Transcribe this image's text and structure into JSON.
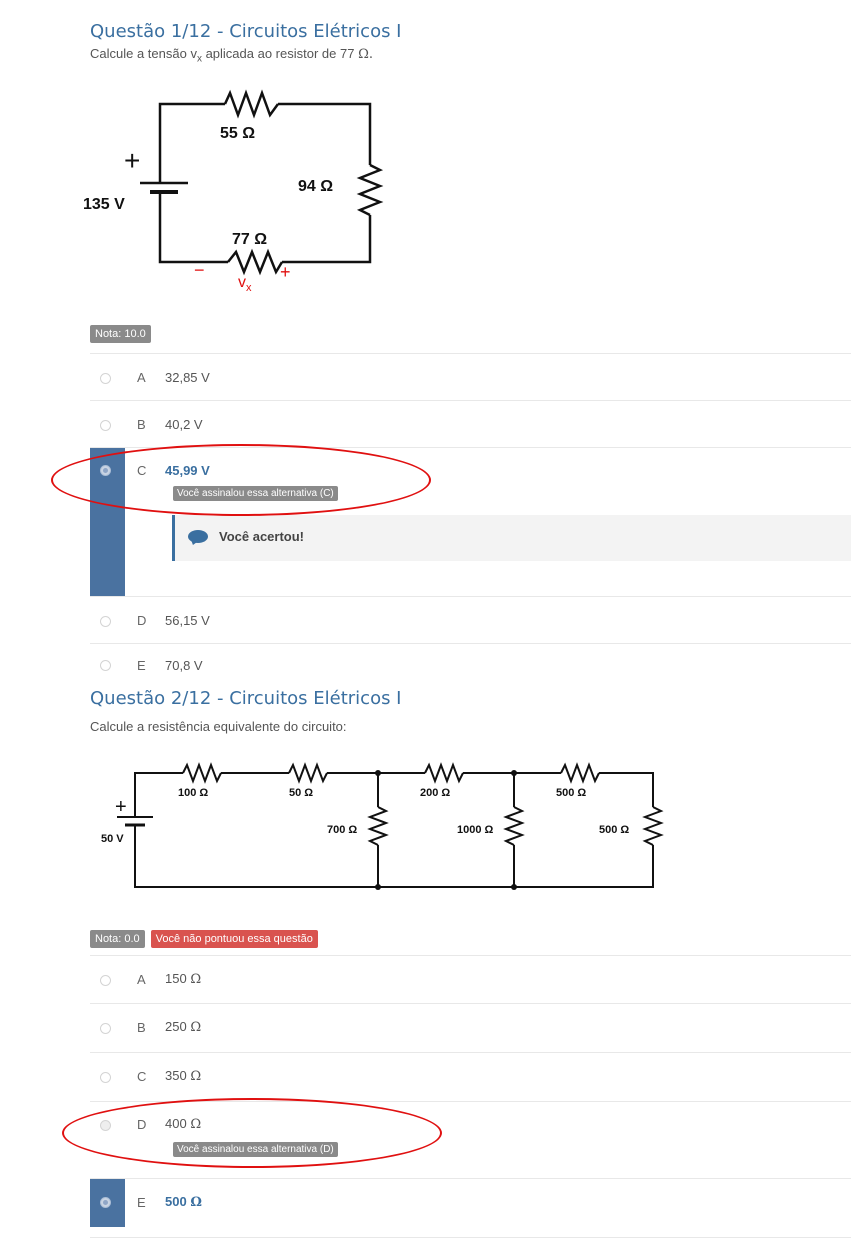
{
  "q1": {
    "title": "Questão 1/12 - Circuitos Elétricos I",
    "prompt_a": "Calcule a tensão v",
    "prompt_sub": "x",
    "prompt_b": " aplicada ao resistor de 77 ",
    "prompt_omega": "Ω.",
    "circuit": {
      "r_top": "55 Ω",
      "r_right": "94 Ω",
      "r_bottom": "77 Ω",
      "source": "135 V",
      "plus": "+",
      "minus_label": "−",
      "plus_label": "+",
      "vx": "v",
      "vx_sub": "x"
    },
    "grade": "Nota: 10.0",
    "options": [
      {
        "letter": "A",
        "text": "32,85 V"
      },
      {
        "letter": "B",
        "text": "40,2 V"
      },
      {
        "letter": "C",
        "text": "45,99 V"
      },
      {
        "letter": "D",
        "text": "56,15 V"
      },
      {
        "letter": "E",
        "text": "70,8 V"
      }
    ],
    "selected_tag": "Você assinalou essa alternativa (C)",
    "feedback": "Você acertou!"
  },
  "q2": {
    "title": "Questão 2/12 - Circuitos Elétricos I",
    "prompt": "Calcule a resistência equivalente do circuito:",
    "circuit": {
      "r1": "100 Ω",
      "r2": "50 Ω",
      "r3": "700 Ω",
      "r4": "200 Ω",
      "r5": "1000 Ω",
      "r6": "500 Ω",
      "r7": "500 Ω",
      "source": "50 V",
      "plus": "+"
    },
    "grade": "Nota: 0.0",
    "status": "Você não pontuou essa questão",
    "options": [
      {
        "letter": "A",
        "value": "150 ",
        "unit": "Ω"
      },
      {
        "letter": "B",
        "value": "250 ",
        "unit": "Ω"
      },
      {
        "letter": "C",
        "value": "350 ",
        "unit": "Ω"
      },
      {
        "letter": "D",
        "value": "400 ",
        "unit": "Ω"
      },
      {
        "letter": "E",
        "value": "500 ",
        "unit": "Ω"
      }
    ],
    "selected_tag": "Você assinalou essa alternativa (D)"
  },
  "colors": {
    "accent": "#4a72a0",
    "title": "#3a6fa0",
    "badge_grey": "#8a8a8a",
    "badge_red": "#d9534f",
    "annotation": "#e01010"
  }
}
